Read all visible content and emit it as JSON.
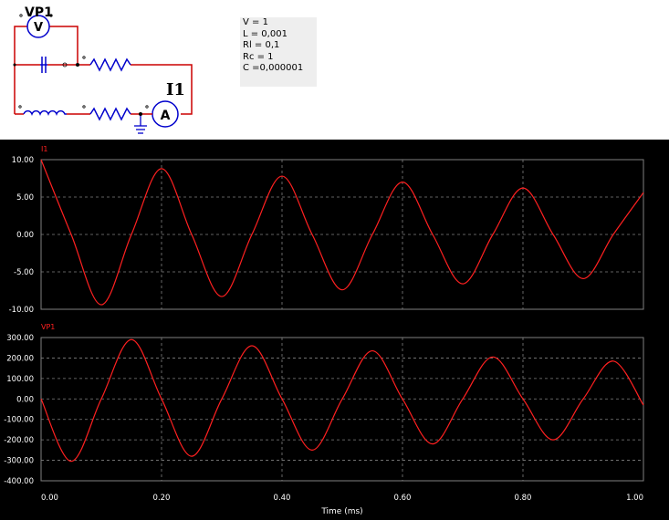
{
  "schematic": {
    "voltmeter_label": "VP1",
    "voltmeter_symbol": "V",
    "ammeter_label": "I1",
    "ammeter_symbol": "A",
    "parameters": [
      "V = 1",
      "L = 0,001",
      "Rl = 0,1",
      "Rc = 1",
      "C =0,000001"
    ]
  },
  "colors": {
    "wire": "#cc0000",
    "component": "#0000cc",
    "trace": "#ff2020",
    "axis_text": "#ffffff",
    "grid": "#808080"
  },
  "chart_data": [
    {
      "type": "line",
      "legend": "I1",
      "ylim": [
        -10,
        10
      ],
      "yticks": [
        "10.00",
        "5.00",
        "0.00",
        "-5.00",
        "-10.00"
      ],
      "ytick_values": [
        10,
        5,
        0,
        -5,
        -10
      ],
      "xlim": [
        0,
        1
      ],
      "xticks": [
        "0.00",
        "0.20",
        "0.40",
        "0.60",
        "0.80",
        "1.00"
      ],
      "xtick_values": [
        0,
        0.2,
        0.4,
        0.6,
        0.8,
        1.0
      ],
      "grid": true,
      "series": [
        {
          "x": [
            0,
            0.05,
            0.1,
            0.15,
            0.2,
            0.25,
            0.3,
            0.35,
            0.4,
            0.45,
            0.5,
            0.55,
            0.6,
            0.65,
            0.7,
            0.75,
            0.8,
            0.85,
            0.9,
            0.95,
            1.0
          ],
          "y": [
            10,
            0,
            -9.4,
            0,
            8.8,
            0,
            -8.3,
            0,
            7.8,
            0,
            -7.4,
            0,
            7.0,
            0,
            -6.6,
            0,
            6.2,
            0,
            -5.9,
            0,
            5.6
          ]
        }
      ]
    },
    {
      "type": "line",
      "legend": "VP1",
      "ylim": [
        -400,
        300
      ],
      "yticks": [
        "300.00",
        "200.00",
        "100.00",
        "0.00",
        "-100.00",
        "-200.00",
        "-300.00",
        "-400.00"
      ],
      "ytick_values": [
        300,
        200,
        100,
        0,
        -100,
        -200,
        -300,
        -400
      ],
      "xlim": [
        0,
        1
      ],
      "xticks": [
        "0.00",
        "0.20",
        "0.40",
        "0.60",
        "0.80",
        "1.00"
      ],
      "xtick_values": [
        0,
        0.2,
        0.4,
        0.6,
        0.8,
        1.0
      ],
      "xlabel": "Time (ms)",
      "grid": true,
      "series": [
        {
          "x": [
            0,
            0.05,
            0.1,
            0.15,
            0.2,
            0.25,
            0.3,
            0.35,
            0.4,
            0.45,
            0.5,
            0.55,
            0.6,
            0.65,
            0.7,
            0.75,
            0.8,
            0.85,
            0.9,
            0.95,
            1.0
          ],
          "y": [
            0,
            -305,
            0,
            290,
            0,
            -280,
            0,
            260,
            0,
            -250,
            0,
            235,
            0,
            -220,
            0,
            205,
            0,
            -200,
            0,
            185,
            -30
          ]
        }
      ]
    }
  ]
}
